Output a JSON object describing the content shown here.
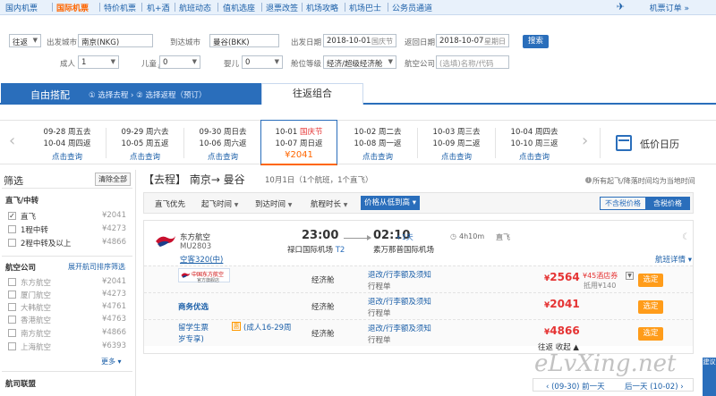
{
  "nav": {
    "items": [
      "国内机票",
      "国际机票",
      "特价机票",
      "机+酒",
      "航班动态",
      "值机选座",
      "退票改签",
      "机场攻略",
      "机场巴士",
      "公务员通道"
    ],
    "order_link": "机票订单 »"
  },
  "search": {
    "trip_type": "往返",
    "from_label": "出发城市",
    "from_value": "南京(NKG)",
    "to_label": "到达城市",
    "to_value": "曼谷(BKK)",
    "depart_label": "出发日期",
    "depart_value": "2018-10-01",
    "depart_hint": "国庆节",
    "return_label": "返回日期",
    "return_value": "2018-10-07",
    "return_hint": "星期日",
    "search_button": "搜索",
    "adult_label": "成人",
    "adult_value": "1",
    "child_label": "儿童",
    "child_value": "0",
    "infant_label": "婴儿",
    "infant_value": "0",
    "cabin_label": "舱位等级",
    "cabin_value": "经济/超级经济舱",
    "airline_label": "航空公司",
    "airline_placeholder": "(选填)名称/代码"
  },
  "mode_tabs": {
    "free_title": "自由搭配",
    "free_steps": "① 选择去程  ›  ② 选择返程（预订）",
    "round_title": "往返组合"
  },
  "dates": [
    {
      "go": "09-28 周五去",
      "ret": "10-04 周四返",
      "action": "点击查询"
    },
    {
      "go": "09-29 周六去",
      "ret": "10-05 周五返",
      "action": "点击查询"
    },
    {
      "go": "09-30 周日去",
      "ret": "10-06 周六返",
      "action": "点击查询"
    },
    {
      "go": "10-01 ",
      "go_holiday": "国庆节",
      "ret": "10-07 周日返",
      "price": "¥2041"
    },
    {
      "go": "10-02 周二去",
      "ret": "10-08 周一返",
      "action": "点击查询"
    },
    {
      "go": "10-03 周三去",
      "ret": "10-09 周二返",
      "action": "点击查询"
    },
    {
      "go": "10-04 周四去",
      "ret": "10-10 周三返",
      "action": "点击查询"
    }
  ],
  "calendar_label": "低价日历",
  "sidebar": {
    "title": "筛选",
    "clear": "清除全部",
    "stops_title": "直飞/中转",
    "stops": [
      {
        "label": "直飞",
        "price": "¥2041",
        "checked": "✓"
      },
      {
        "label": "1程中转",
        "price": "¥4273",
        "checked": ""
      },
      {
        "label": "2程中转及以上",
        "price": "¥4866",
        "checked": ""
      }
    ],
    "airline_title": "航空公司",
    "airline_link": "展开航司排序筛选",
    "airlines": [
      {
        "label": "东方航空",
        "price": "¥2041"
      },
      {
        "label": "厦门航空",
        "price": "¥4273"
      },
      {
        "label": "大韩航空",
        "price": "¥4761"
      },
      {
        "label": "香港航空",
        "price": "¥4763"
      },
      {
        "label": "南方航空",
        "price": "¥4866"
      },
      {
        "label": "上海航空",
        "price": "¥6393"
      }
    ],
    "more": "更多 ▾",
    "alliance_title": "航司联盟"
  },
  "main": {
    "route_title": "【去程】 南京→ 曼谷",
    "route_sub": "10月1日（1个航班，1个直飞）",
    "tz_note": "所有起飞/降落时间均为当地时间",
    "sort": {
      "direct": "直飞优先",
      "dep": "起飞时间",
      "arr": "到达时间",
      "dur": "航程时长",
      "price": "价格从低到高"
    },
    "tax_off": "不含税价格",
    "tax_on": "含税价格"
  },
  "flight": {
    "airline": "东方航空",
    "number": "MU2803",
    "aircraft": "空客320(中)",
    "dep_time": "23:00",
    "dep_airport": "禄口国际机场",
    "dep_terminal": "T2",
    "arr_time": "02:10",
    "next_day": "+1天",
    "arr_airport": "素万那普国际机场",
    "duration": "4h10m",
    "direct": "直飞",
    "details": "航班详情 ▾"
  },
  "price_rows": [
    {
      "badge_text": "中国东方航空",
      "badge_sub": "官方旗舰店",
      "cabin": "经济舱",
      "rules": "退改/行李额及须知",
      "itin": "行程单",
      "currency": "¥",
      "price": "2564",
      "hotel": "¥45酒店券",
      "hotel_sub": "抵用¥140",
      "book": "选定"
    },
    {
      "label": "商务优选",
      "cabin": "经济舱",
      "rules": "退改/行李额及须知",
      "itin": "行程单",
      "currency": "¥",
      "price": "2041",
      "book": "选定"
    },
    {
      "label": "留学生票",
      "tag": "惠",
      "label2": "(成人16-29周",
      "label3": "岁专享)",
      "cabin": "经济舱",
      "rules": "退改/行李额及须知",
      "itin": "行程单",
      "currency": "¥",
      "price": "4866",
      "book": "选定"
    }
  ],
  "collapse": "往返 收起 ▲",
  "bottom": {
    "prev": "‹ (09-30) 前一天",
    "next": "后一天 (10-02) ›"
  },
  "watermark": "eLvXing.net",
  "side_tab": "建议"
}
